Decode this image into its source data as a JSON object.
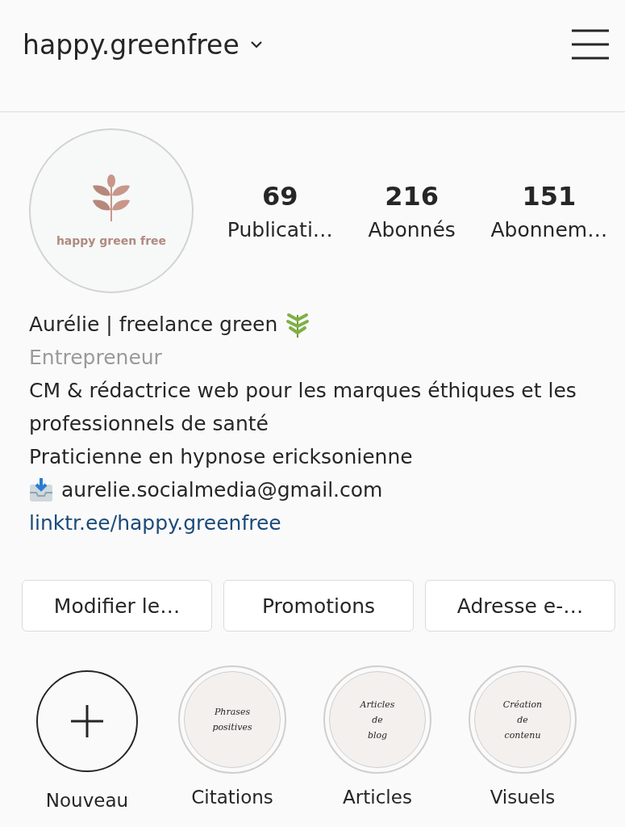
{
  "header": {
    "username": "happy.greenfree"
  },
  "profile": {
    "logo_text": "happy green free",
    "stats": [
      {
        "value": "69",
        "label": "Publicati…"
      },
      {
        "value": "216",
        "label": "Abonnés"
      },
      {
        "value": "151",
        "label": "Abonnem…"
      }
    ]
  },
  "bio": {
    "name": "Aurélie | freelance green",
    "category": "Entrepreneur",
    "lines": [
      "CM & rédactrice web pour les marques éthiques et les professionnels de santé",
      "Praticienne en hypnose ericksonienne"
    ],
    "email": "aurelie.socialmedia@gmail.com",
    "link": "linktr.ee/happy.greenfree"
  },
  "buttons": [
    "Modifier le…",
    "Promotions",
    "Adresse e-…"
  ],
  "highlights": [
    {
      "kind": "new",
      "label": "Nouveau"
    },
    {
      "kind": "cover",
      "label": "Citations",
      "cover_text": [
        "Phrases",
        "positives"
      ]
    },
    {
      "kind": "cover",
      "label": "Articles",
      "cover_text": [
        "Articles",
        "de",
        "blog"
      ]
    },
    {
      "kind": "cover",
      "label": "Visuels",
      "cover_text": [
        "Création",
        "de",
        "contenu"
      ]
    }
  ]
}
